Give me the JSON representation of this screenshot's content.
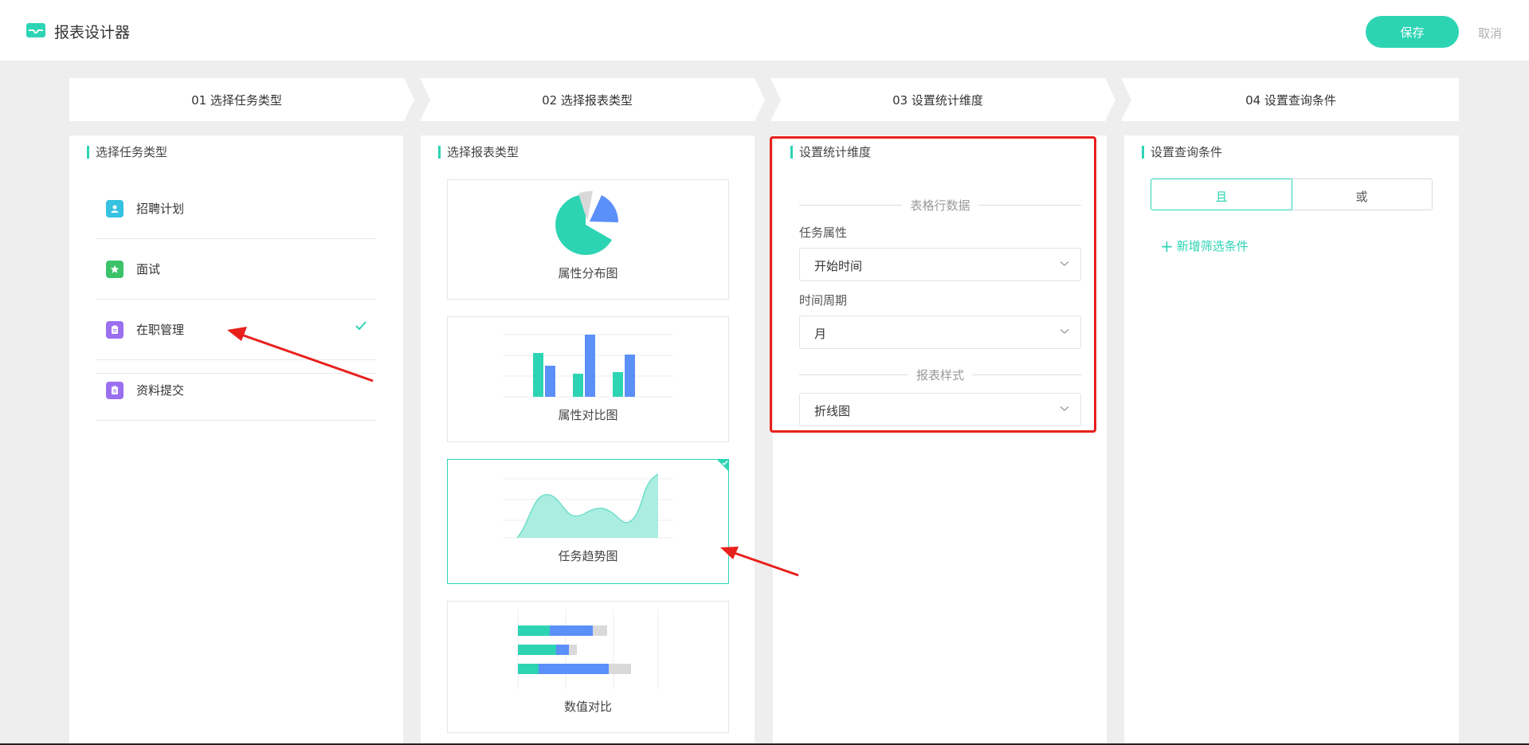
{
  "header": {
    "title": "报表设计器",
    "save_label": "保存",
    "cancel_label": "取消"
  },
  "steps": [
    {
      "label": "01 选择任务类型"
    },
    {
      "label": "02 选择报表类型"
    },
    {
      "label": "03 设置统计维度"
    },
    {
      "label": "04 设置查询条件"
    }
  ],
  "task_panel": {
    "title": "选择任务类型",
    "items": [
      {
        "label": "招聘计划",
        "icon": "person-icon",
        "color": "#36c2e0",
        "selected": false
      },
      {
        "label": "面试",
        "icon": "star-icon",
        "color": "#3cc36a",
        "selected": false
      },
      {
        "label": "在职管理",
        "icon": "clipboard-icon",
        "color": "#9a6ff0",
        "selected": true
      },
      {
        "label": "资料提交",
        "icon": "clipboard-icon",
        "color": "#9a6ff0",
        "selected": false
      }
    ]
  },
  "report_panel": {
    "title": "选择报表类型",
    "cards": [
      {
        "label": "属性分布图",
        "icon": "pie-chart-icon",
        "selected": false
      },
      {
        "label": "属性对比图",
        "icon": "bar-chart-icon",
        "selected": false
      },
      {
        "label": "任务趋势图",
        "icon": "area-chart-icon",
        "selected": true
      },
      {
        "label": "数值对比",
        "icon": "stacked-bar-icon",
        "selected": false
      }
    ]
  },
  "dimension_panel": {
    "title": "设置统计维度",
    "row_section": "表格行数据",
    "task_attr_label": "任务属性",
    "task_attr_value": "开始时间",
    "period_label": "时间周期",
    "period_value": "月",
    "style_section": "报表样式",
    "style_value": "折线图"
  },
  "query_panel": {
    "title": "设置查询条件",
    "and_label": "且",
    "or_label": "或",
    "add_filter_label": "新增筛选条件"
  },
  "colors": {
    "accent": "#2dd4b4",
    "chart_blue": "#5b8ff9",
    "annotation_red": "#e8201c"
  }
}
